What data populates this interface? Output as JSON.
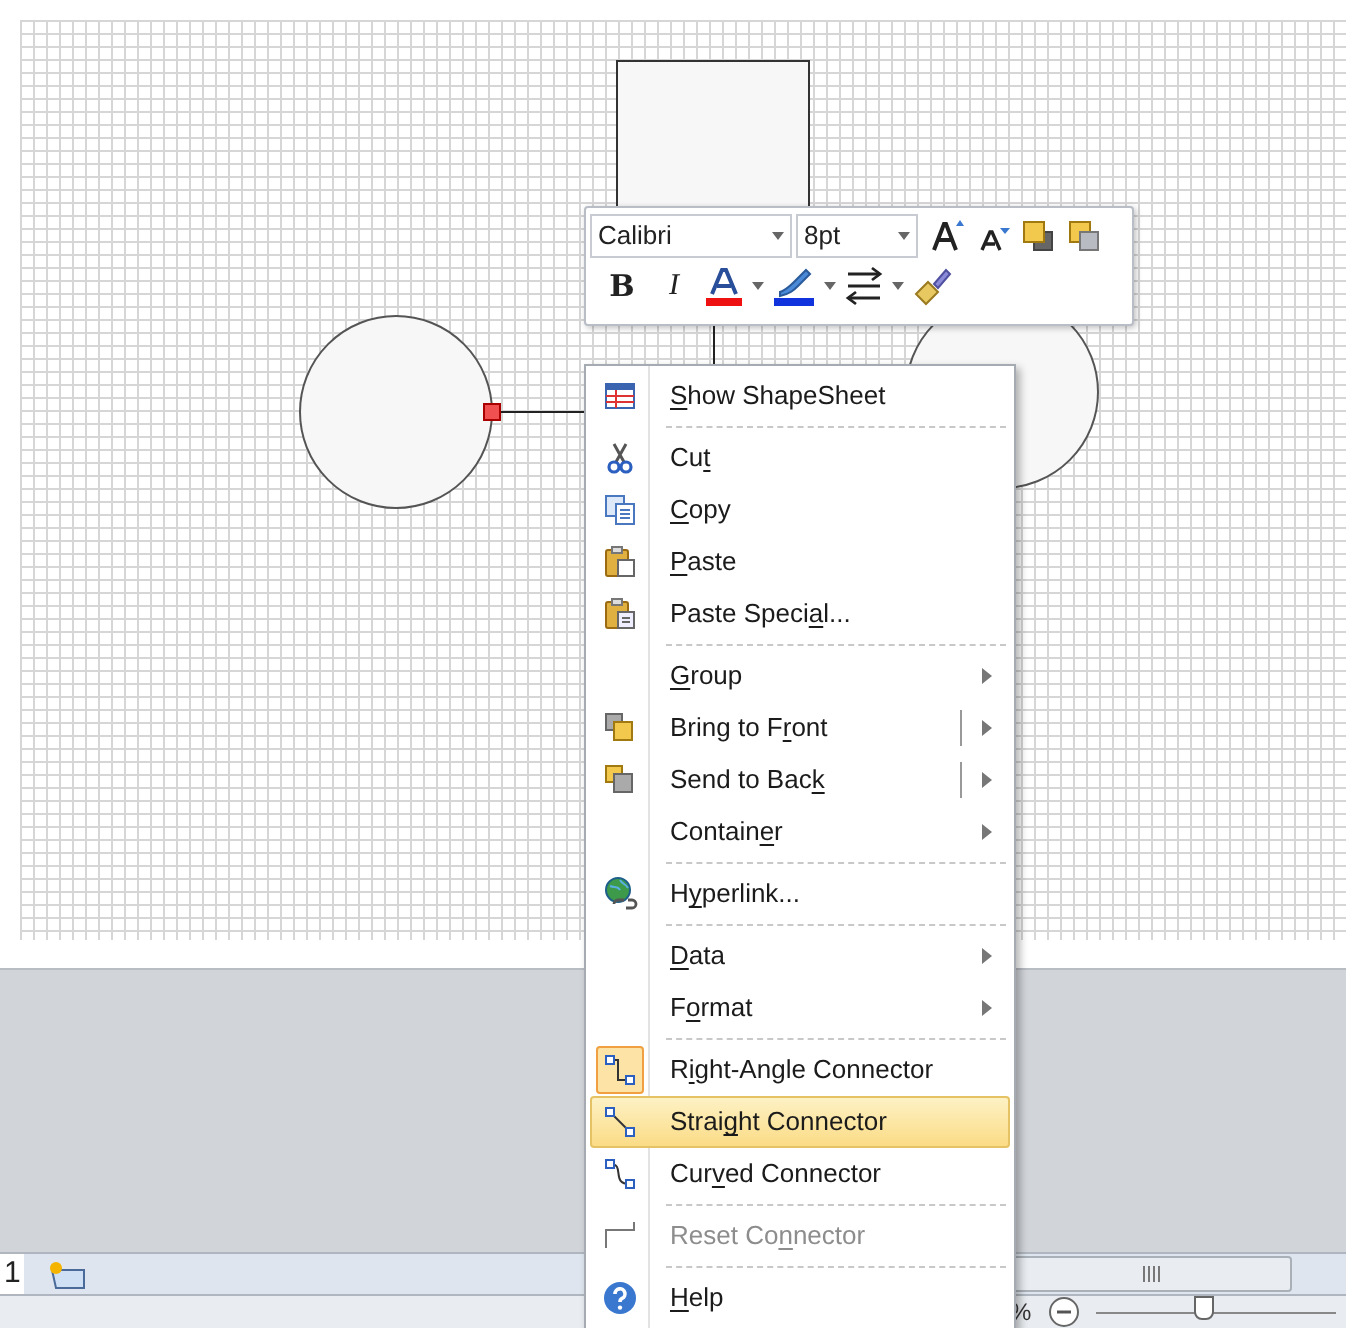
{
  "mini_toolbar": {
    "font": "Calibri",
    "font_size": "8pt",
    "buttons": [
      {
        "kind": "bold",
        "label": "B"
      },
      {
        "kind": "italic",
        "label": "I"
      }
    ]
  },
  "context_menu": {
    "items": [
      {
        "kind": "command",
        "key": "S",
        "after": "how ShapeSheet",
        "selected": false,
        "disabled": false,
        "checked": false,
        "separator_after": true
      },
      {
        "kind": "command",
        "before": "Cu",
        "key": "t",
        "selected": false,
        "disabled": false,
        "checked": false,
        "separator_after": false
      },
      {
        "kind": "command",
        "key": "C",
        "after": "opy",
        "selected": false,
        "disabled": false,
        "checked": false,
        "separator_after": false
      },
      {
        "kind": "command",
        "key": "P",
        "after": "aste",
        "selected": false,
        "disabled": false,
        "checked": false,
        "separator_after": false
      },
      {
        "kind": "command",
        "before": "Paste Speci",
        "key": "a",
        "after": "l...",
        "selected": false,
        "disabled": false,
        "checked": false,
        "separator_after": true
      },
      {
        "kind": "submenu",
        "key": "G",
        "after": "roup",
        "selected": false,
        "disabled": false,
        "checked": false,
        "separator_after": false
      },
      {
        "kind": "split",
        "before": "Bring to F",
        "key": "r",
        "after": "ont",
        "selected": false,
        "disabled": false,
        "checked": false,
        "separator_after": false
      },
      {
        "kind": "split",
        "before": "Send to Bac",
        "key": "k",
        "selected": false,
        "disabled": false,
        "checked": false,
        "separator_after": false
      },
      {
        "kind": "submenu",
        "before": "Contain",
        "key": "e",
        "after": "r",
        "selected": false,
        "disabled": false,
        "checked": false,
        "separator_after": true
      },
      {
        "kind": "command",
        "before": "H",
        "key": "y",
        "after": "perlink...",
        "selected": false,
        "disabled": false,
        "checked": false,
        "separator_after": true
      },
      {
        "kind": "submenu",
        "key": "D",
        "after": "ata",
        "selected": false,
        "disabled": false,
        "checked": false,
        "separator_after": false
      },
      {
        "kind": "submenu",
        "before": "F",
        "key": "o",
        "after": "rmat",
        "selected": false,
        "disabled": false,
        "checked": false,
        "separator_after": true
      },
      {
        "kind": "command",
        "before": "R",
        "key": "i",
        "after": "ght-Angle Connector",
        "selected": false,
        "disabled": false,
        "checked": true,
        "separator_after": false
      },
      {
        "kind": "command",
        "before": "Strai",
        "key": "g",
        "after": "ht Connector",
        "selected": true,
        "disabled": false,
        "checked": false,
        "separator_after": false
      },
      {
        "kind": "command",
        "before": "Cur",
        "key": "v",
        "after": "ed Connector",
        "selected": false,
        "disabled": false,
        "checked": false,
        "separator_after": true
      },
      {
        "kind": "command",
        "before": "Reset Co",
        "key": "n",
        "after": "nector",
        "selected": false,
        "disabled": true,
        "checked": false,
        "separator_after": true
      },
      {
        "kind": "command",
        "key": "H",
        "after": "elp",
        "selected": false,
        "disabled": false,
        "checked": false,
        "separator_after": false
      }
    ]
  },
  "page_tabs": [
    {
      "label": "1",
      "selected": true
    }
  ],
  "status_bar": {
    "zoom_unit": "%",
    "zoom_slider": {
      "level": 0.45
    }
  }
}
